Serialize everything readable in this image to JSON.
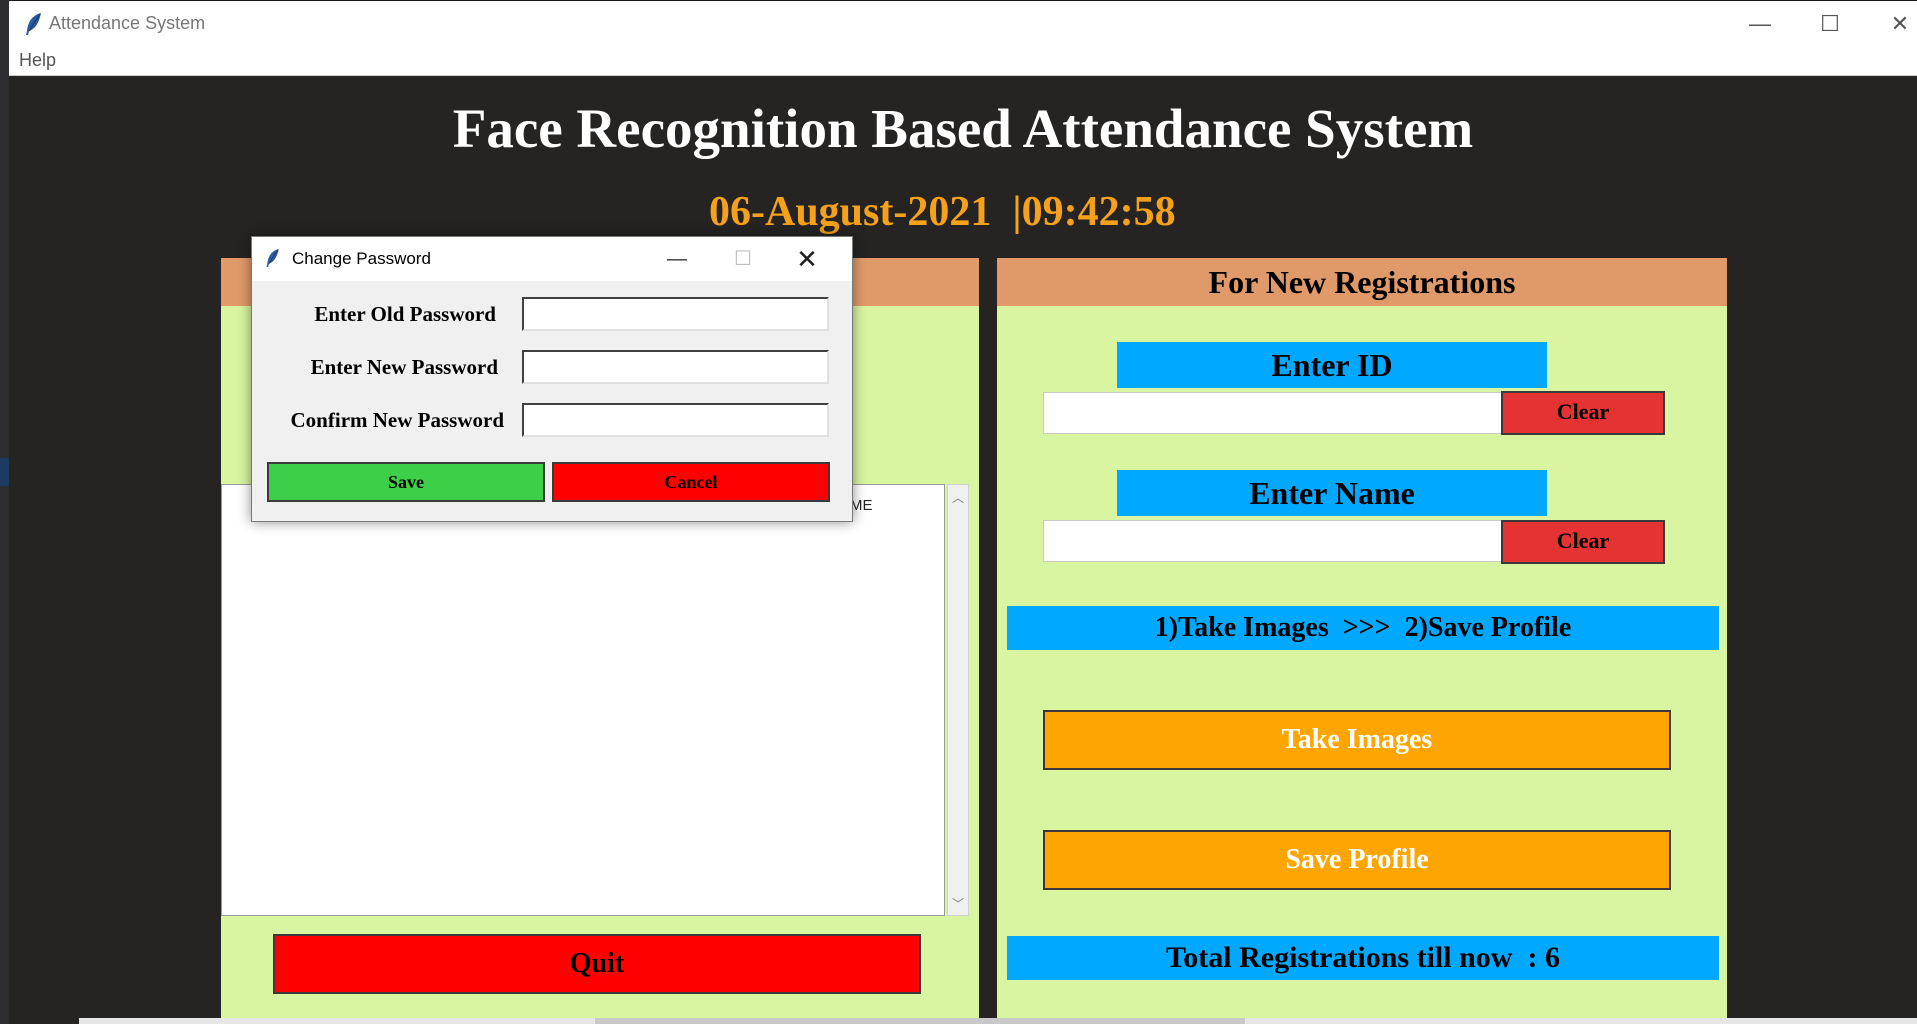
{
  "window": {
    "title": "Attendance System",
    "icon": "feather-icon",
    "controls": {
      "minimize": "—",
      "maximize": "☐",
      "close": "✕"
    }
  },
  "menu": {
    "help": "Help"
  },
  "header": {
    "title": "Face Recognition Based Attendance System",
    "datetime": "06-August-2021  |09:42:58"
  },
  "left_panel": {
    "table_column_partial": "ME"
  },
  "quit_label": "Quit",
  "right_panel": {
    "header": "For New Registrations",
    "enter_id_label": "Enter ID",
    "id_value": "",
    "clear_label": "Clear",
    "enter_name_label": "Enter Name",
    "name_value": "",
    "steps": "1)Take Images  >>>  2)Save Profile",
    "take_images": "Take Images",
    "save_profile": "Save Profile",
    "total_registrations": "Total Registrations till now  : 6"
  },
  "dialog": {
    "title": "Change Password",
    "old_password_label": "Enter Old Password",
    "new_password_label": "Enter New Password",
    "confirm_password_label": "Confirm New Password",
    "old_password_value": "",
    "new_password_value": "",
    "confirm_password_value": "",
    "save": "Save",
    "cancel": "Cancel"
  },
  "colors": {
    "background": "#252423",
    "panel": "#d9f5a1",
    "panel_header": "#e09a6a",
    "cyan": "#00a9ff",
    "orange": "#ffa500",
    "red": "#ff0000",
    "green": "#3ecf48",
    "datetime": "#f5a11b"
  }
}
